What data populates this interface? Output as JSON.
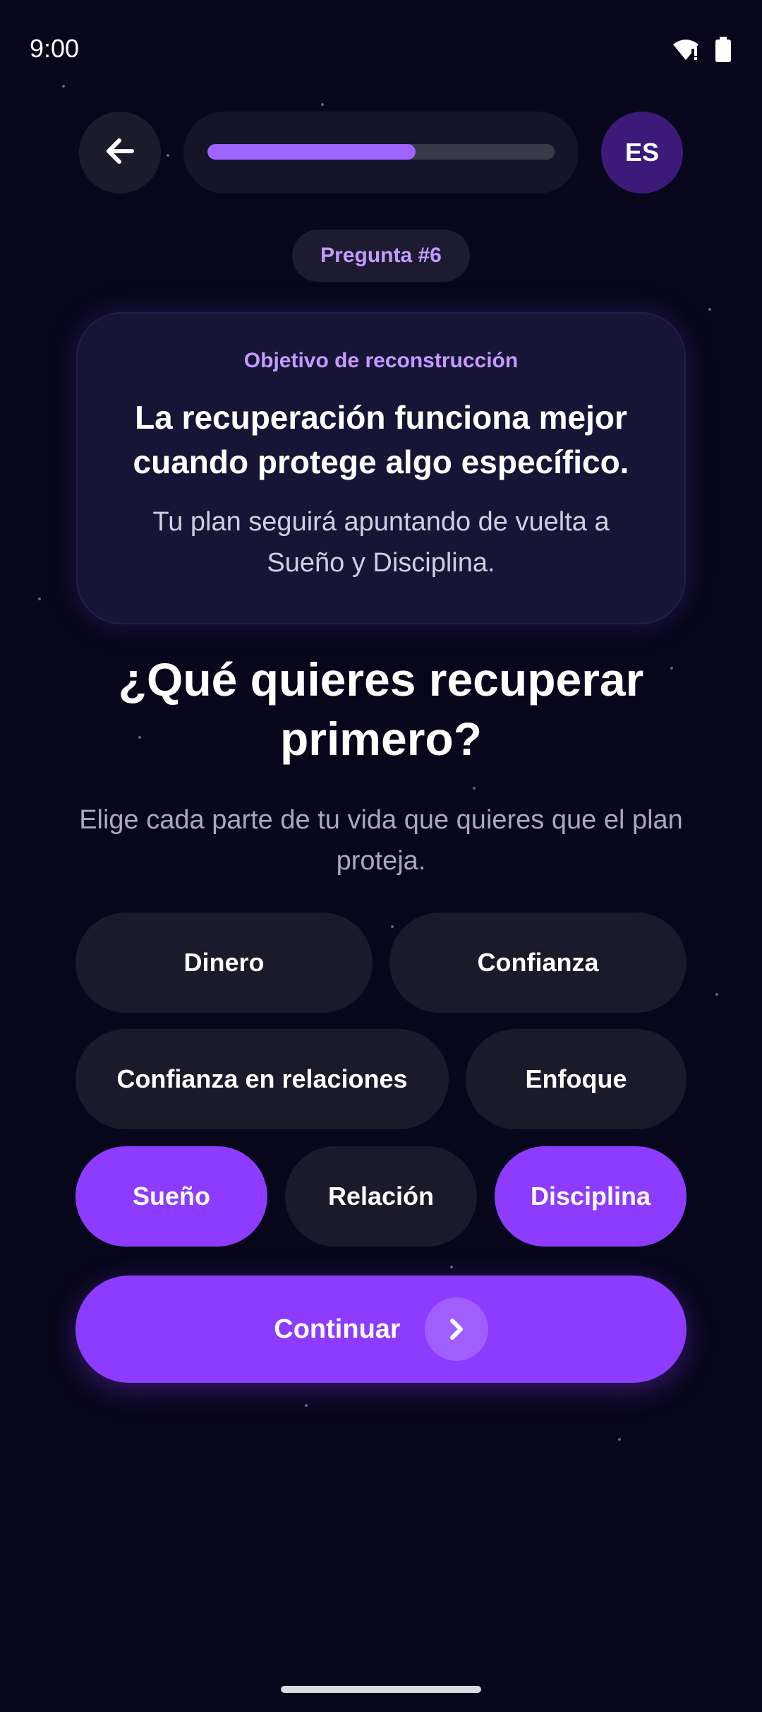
{
  "status_bar": {
    "time": "9:00",
    "wifi_icon": "wifi-alert-icon",
    "battery_icon": "battery-icon"
  },
  "header": {
    "back_icon": "arrow-left-icon",
    "progress_fraction": 0.6,
    "language": "ES"
  },
  "question_badge": "Pregunta #6",
  "card": {
    "subtitle": "Objetivo de reconstrucción",
    "headline": "La recuperación funciona mejor cuando protege algo específico.",
    "body": "Tu plan seguirá apuntando de vuelta a Sueño y Disciplina."
  },
  "question": "¿Qué quieres recuperar primero?",
  "hint": "Elige cada parte de tu vida que quieres que el plan proteja.",
  "options": [
    {
      "label": "Dinero",
      "selected": false
    },
    {
      "label": "Confianza",
      "selected": false
    },
    {
      "label": "Confianza en relaciones",
      "selected": false
    },
    {
      "label": "Enfoque",
      "selected": false
    },
    {
      "label": "Sueño",
      "selected": true
    },
    {
      "label": "Relación",
      "selected": false
    },
    {
      "label": "Disciplina",
      "selected": true
    }
  ],
  "continue": {
    "label": "Continuar",
    "icon": "chevron-right-icon"
  },
  "colors": {
    "background": "#07061a",
    "accent": "#8d3bff",
    "accent_text": "#c49bff",
    "chip": "#1b1a2b"
  }
}
